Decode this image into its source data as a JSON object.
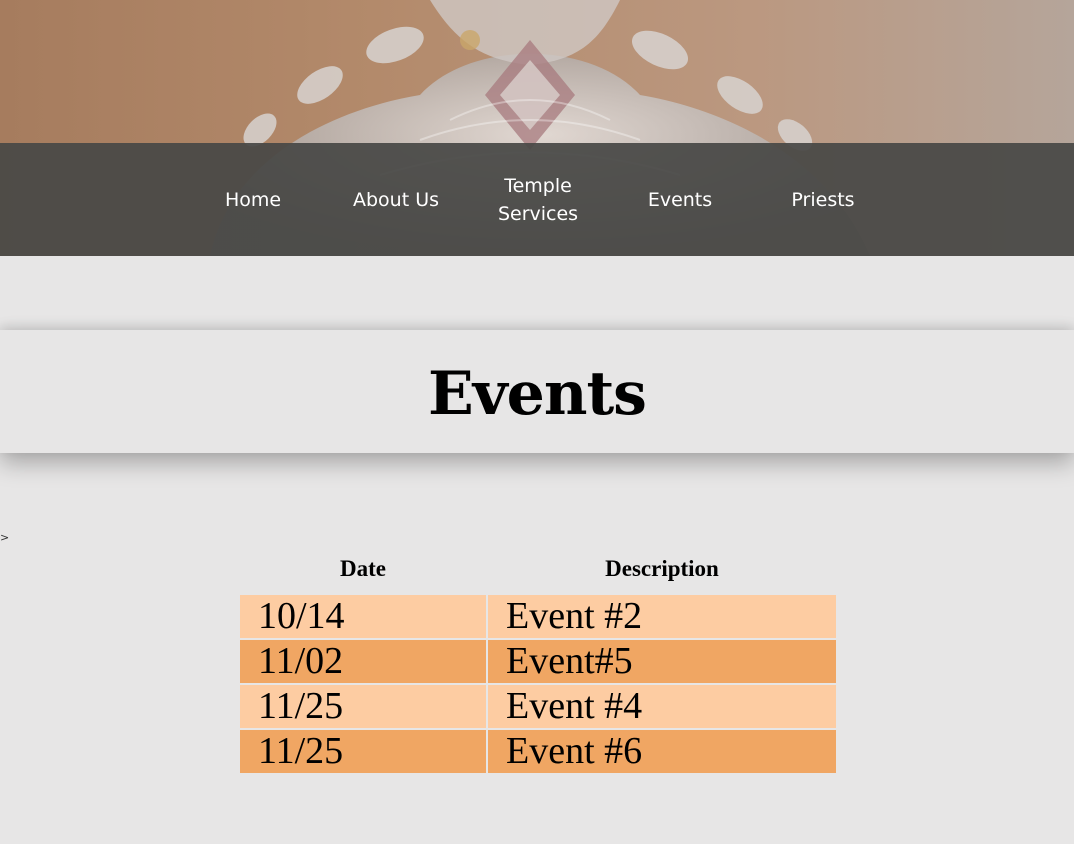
{
  "nav": {
    "items": [
      {
        "label": "Home"
      },
      {
        "label": "About Us"
      },
      {
        "label_line1": "Temple",
        "label_line2": "Services"
      },
      {
        "label": "Events"
      },
      {
        "label": "Priests"
      }
    ]
  },
  "page": {
    "title": "Events",
    "stray_text": ">"
  },
  "events_table": {
    "headers": [
      "Date",
      "Description"
    ],
    "rows": [
      {
        "date": "10/14",
        "description": "Event #2"
      },
      {
        "date": "11/02",
        "description": "Event#5"
      },
      {
        "date": "11/25",
        "description": "Event #4"
      },
      {
        "date": "11/25",
        "description": "Event #6"
      }
    ]
  },
  "colors": {
    "navbar": "#4a4a48",
    "background": "#e7e6e6",
    "row_light": "#fdcca2",
    "row_dark": "#f0a663"
  }
}
